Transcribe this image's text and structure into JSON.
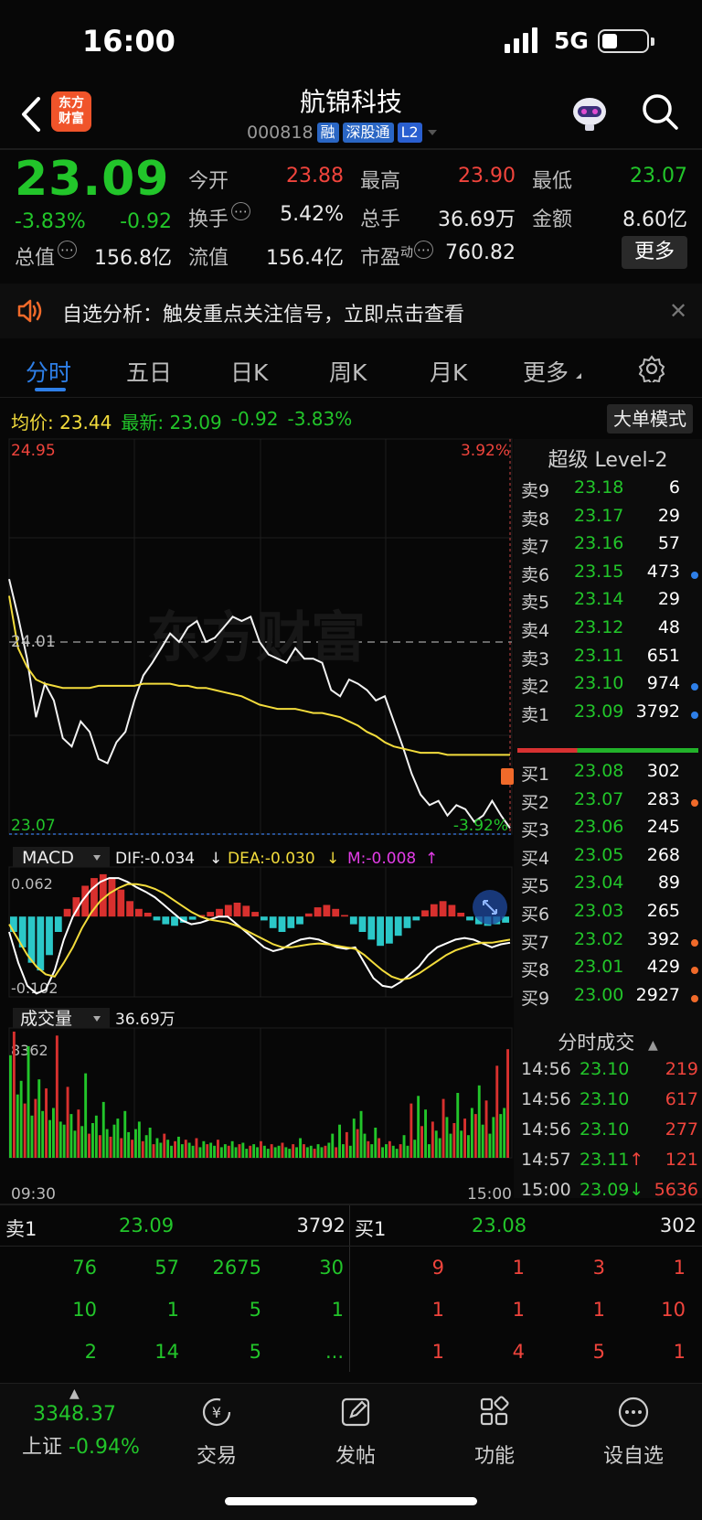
{
  "status": {
    "time": "16:00",
    "network": "5G"
  },
  "header": {
    "logo_text": "东方财富",
    "stock_name": "航锦科技",
    "stock_code": "000818",
    "tags": [
      "融",
      "深股通",
      "L2"
    ]
  },
  "quote": {
    "price": "23.09",
    "change_pct": "-3.83%",
    "change": "-0.92",
    "open_label": "今开",
    "open": "23.88",
    "high_label": "最高",
    "high": "23.90",
    "low_label": "最低",
    "low": "23.07",
    "turnover_label": "换手",
    "turnover": "5.42%",
    "volume_label": "总手",
    "volume": "36.69万",
    "amount_label": "金额",
    "amount": "8.60亿",
    "mktcap_label": "总值",
    "mktcap": "156.8亿",
    "float_label": "流值",
    "float": "156.4亿",
    "pe_label": "市盈",
    "pe_sup": "动",
    "pe": "760.82",
    "more_label": "更多"
  },
  "alert": {
    "text": "自选分析：触发重点关注信号，立即点击查看"
  },
  "tabs": [
    "分时",
    "五日",
    "日K",
    "周K",
    "月K",
    "更多"
  ],
  "info_line": {
    "avg_label": "均价:",
    "avg": "23.44",
    "latest_label": "最新:",
    "latest": "23.09",
    "change": "-0.92",
    "change_pct": "-3.83%"
  },
  "big_order_btn": "大单模式",
  "chart_data": [
    {
      "type": "line",
      "name": "分时",
      "ylim": [
        23.07,
        24.95
      ],
      "y_top_label": "24.95",
      "y_top_pct": "3.92%",
      "y_mid_label": "24.01",
      "y_bottom_label": "23.07",
      "y_bottom_pct": "-3.92%",
      "watermark": "东方财富",
      "x_labels": [
        "09:30",
        "15:00"
      ],
      "price": [
        24.28,
        24.1,
        23.9,
        23.62,
        23.78,
        23.7,
        23.52,
        23.48,
        23.6,
        23.55,
        23.42,
        23.4,
        23.5,
        23.55,
        23.7,
        23.82,
        23.88,
        23.95,
        24.02,
        23.98,
        24.05,
        24.08,
        23.98,
        24.0,
        24.05,
        24.1,
        24.08,
        24.1,
        23.98,
        23.92,
        23.9,
        23.88,
        23.95,
        23.9,
        23.9,
        23.88,
        23.75,
        23.72,
        23.8,
        23.78,
        23.75,
        23.7,
        23.72,
        23.6,
        23.48,
        23.35,
        23.25,
        23.2,
        23.22,
        23.15,
        23.2,
        23.18,
        23.12,
        23.15,
        23.22,
        23.15,
        23.09
      ],
      "avg": [
        24.2,
        23.95,
        23.86,
        23.8,
        23.78,
        23.77,
        23.76,
        23.76,
        23.76,
        23.76,
        23.77,
        23.77,
        23.77,
        23.77,
        23.77,
        23.78,
        23.78,
        23.78,
        23.78,
        23.77,
        23.77,
        23.76,
        23.76,
        23.75,
        23.74,
        23.73,
        23.72,
        23.7,
        23.68,
        23.67,
        23.66,
        23.66,
        23.66,
        23.65,
        23.64,
        23.64,
        23.63,
        23.62,
        23.6,
        23.58,
        23.55,
        23.53,
        23.5,
        23.48,
        23.47,
        23.46,
        23.45,
        23.45,
        23.45,
        23.44,
        23.44,
        23.44,
        23.44,
        23.44,
        23.44,
        23.44,
        23.44
      ]
    },
    {
      "type": "bar",
      "name": "MACD",
      "selector": "MACD",
      "dif_label": "DIF:-0.034",
      "dea_label": "DEA:-0.030",
      "m_label": "M:-0.008",
      "ylim": [
        -0.102,
        0.062
      ],
      "y_top_label": "0.062",
      "y_bottom_label": "-0.102",
      "hist": [
        -0.02,
        -0.04,
        -0.06,
        -0.07,
        -0.05,
        -0.02,
        0.01,
        0.025,
        0.04,
        0.05,
        0.055,
        0.05,
        0.035,
        0.02,
        0.01,
        0.005,
        -0.005,
        -0.01,
        -0.012,
        -0.008,
        -0.004,
        0.002,
        0.006,
        0.01,
        0.015,
        0.018,
        0.014,
        0.006,
        -0.005,
        -0.015,
        -0.02,
        -0.015,
        -0.01,
        0.004,
        0.012,
        0.015,
        0.01,
        0.002,
        -0.01,
        -0.02,
        -0.03,
        -0.038,
        -0.035,
        -0.025,
        -0.015,
        -0.005,
        0.008,
        0.016,
        0.02,
        0.015,
        0.005,
        -0.005,
        -0.01,
        -0.012,
        -0.01,
        -0.008
      ],
      "dif": [
        -0.02,
        -0.06,
        -0.09,
        -0.1,
        -0.095,
        -0.07,
        -0.03,
        0.0,
        0.02,
        0.035,
        0.045,
        0.05,
        0.05,
        0.045,
        0.038,
        0.032,
        0.025,
        0.015,
        0.005,
        -0.005,
        -0.01,
        -0.008,
        -0.004,
        0.0,
        0.0,
        -0.01,
        -0.02,
        -0.03,
        -0.04,
        -0.045,
        -0.042,
        -0.035,
        -0.03,
        -0.028,
        -0.03,
        -0.035,
        -0.04,
        -0.042,
        -0.04,
        -0.06,
        -0.08,
        -0.09,
        -0.092,
        -0.085,
        -0.075,
        -0.065,
        -0.05,
        -0.04,
        -0.035,
        -0.03,
        -0.028,
        -0.03,
        -0.035,
        -0.04,
        -0.036,
        -0.034
      ],
      "dea": [
        -0.01,
        -0.03,
        -0.05,
        -0.065,
        -0.075,
        -0.078,
        -0.06,
        -0.04,
        -0.015,
        0.005,
        0.02,
        0.03,
        0.037,
        0.042,
        0.042,
        0.04,
        0.036,
        0.03,
        0.022,
        0.014,
        0.006,
        0.0,
        -0.004,
        -0.006,
        -0.008,
        -0.012,
        -0.018,
        -0.024,
        -0.03,
        -0.036,
        -0.04,
        -0.04,
        -0.038,
        -0.036,
        -0.035,
        -0.036,
        -0.038,
        -0.04,
        -0.042,
        -0.05,
        -0.06,
        -0.07,
        -0.078,
        -0.082,
        -0.08,
        -0.074,
        -0.066,
        -0.058,
        -0.05,
        -0.044,
        -0.04,
        -0.036,
        -0.034,
        -0.034,
        -0.032,
        -0.03
      ]
    },
    {
      "type": "bar",
      "name": "成交量",
      "selector": "成交量",
      "total_label": "36.69万",
      "y_top_label": "8362",
      "x_labels": [
        "09:30",
        "15:00"
      ],
      "values": [
        6800,
        8362,
        4200,
        5100,
        3600,
        7400,
        2800,
        3900,
        5200,
        3100,
        4600,
        2500,
        3300,
        8100,
        2400,
        2200,
        4700,
        2900,
        1800,
        3200,
        2100,
        5600,
        1600,
        2300,
        2800,
        1500,
        3700,
        1900,
        1400,
        2200,
        2600,
        1300,
        3100,
        1700,
        1200,
        1900,
        2400,
        1100,
        1500,
        2000,
        900,
        1300,
        1000,
        1600,
        1200,
        800,
        1100,
        1400,
        900,
        1200,
        1000,
        800,
        1300,
        700,
        1100,
        900,
        1000,
        800,
        1200,
        700,
        900,
        800,
        1100,
        700,
        900,
        1000,
        600,
        800,
        900,
        700,
        1100,
        800,
        600,
        900,
        700,
        800,
        1000,
        700,
        600,
        900,
        700,
        1300,
        900,
        700,
        800,
        600,
        900,
        700,
        800,
        1000,
        1600,
        700,
        2200,
        900,
        1700,
        800,
        2600,
        1900,
        3100,
        1600,
        1100,
        900,
        2000,
        1300,
        700,
        900,
        1100,
        800,
        600,
        900,
        1500,
        800,
        3600,
        1200,
        4100,
        2100,
        3200,
        900,
        2400,
        1800,
        1300,
        3900,
        2700,
        1600,
        2300,
        4300,
        1800,
        2600,
        1500,
        3300,
        2900,
        4800,
        2200,
        3800,
        1600,
        2700,
        6100,
        2900,
        3300,
        7200
      ],
      "colors": "alternate"
    }
  ],
  "orderbook": {
    "title": "超级 Level-2",
    "sells": [
      {
        "label": "卖9",
        "price": "23.18",
        "vol": "6",
        "dot": ""
      },
      {
        "label": "卖8",
        "price": "23.17",
        "vol": "29",
        "dot": ""
      },
      {
        "label": "卖7",
        "price": "23.16",
        "vol": "57",
        "dot": ""
      },
      {
        "label": "卖6",
        "price": "23.15",
        "vol": "473",
        "dot": "#2e7fe8"
      },
      {
        "label": "卖5",
        "price": "23.14",
        "vol": "29",
        "dot": ""
      },
      {
        "label": "卖4",
        "price": "23.12",
        "vol": "48",
        "dot": ""
      },
      {
        "label": "卖3",
        "price": "23.11",
        "vol": "651",
        "dot": ""
      },
      {
        "label": "卖2",
        "price": "23.10",
        "vol": "974",
        "dot": "#2e7fe8"
      },
      {
        "label": "卖1",
        "price": "23.09",
        "vol": "3792",
        "dot": "#2e7fe8"
      }
    ],
    "buys": [
      {
        "label": "买1",
        "price": "23.08",
        "vol": "302",
        "dot": ""
      },
      {
        "label": "买2",
        "price": "23.07",
        "vol": "283",
        "dot": "#f06a2a"
      },
      {
        "label": "买3",
        "price": "23.06",
        "vol": "245",
        "dot": ""
      },
      {
        "label": "买4",
        "price": "23.05",
        "vol": "268",
        "dot": ""
      },
      {
        "label": "买5",
        "price": "23.04",
        "vol": "89",
        "dot": ""
      },
      {
        "label": "买6",
        "price": "23.03",
        "vol": "265",
        "dot": ""
      },
      {
        "label": "买7",
        "price": "23.02",
        "vol": "392",
        "dot": "#f06a2a"
      },
      {
        "label": "买8",
        "price": "23.01",
        "vol": "429",
        "dot": "#f06a2a"
      },
      {
        "label": "买9",
        "price": "23.00",
        "vol": "2927",
        "dot": "#f06a2a"
      }
    ],
    "trades_title": "分时成交",
    "trades": [
      {
        "time": "14:56",
        "price": "23.10",
        "arrow": "",
        "vol": "219"
      },
      {
        "time": "14:56",
        "price": "23.10",
        "arrow": "",
        "vol": "617"
      },
      {
        "time": "14:56",
        "price": "23.10",
        "arrow": "",
        "vol": "277"
      },
      {
        "time": "14:57",
        "price": "23.11",
        "arrow": "↑",
        "vol": "121"
      },
      {
        "time": "15:00",
        "price": "23.09",
        "arrow": "↓",
        "vol": "5636"
      }
    ]
  },
  "depth": {
    "sell_label": "卖1",
    "sell_price": "23.09",
    "sell_vol": "3792",
    "buy_label": "买1",
    "buy_price": "23.08",
    "buy_vol": "302",
    "sell_rows": [
      [
        "76",
        "57",
        "2675",
        "30"
      ],
      [
        "10",
        "1",
        "5",
        "1"
      ],
      [
        "2",
        "14",
        "5",
        "..."
      ]
    ],
    "buy_rows": [
      [
        "9",
        "1",
        "3",
        "1"
      ],
      [
        "1",
        "1",
        "1",
        "10"
      ],
      [
        "1",
        "4",
        "5",
        "1"
      ]
    ]
  },
  "bottom_nav": {
    "index_value": "3348.37",
    "index_name": "上证",
    "index_change": "-0.94%",
    "items": [
      "交易",
      "发帖",
      "功能",
      "设自选"
    ]
  },
  "colors": {
    "up": "#f0443c",
    "down": "#22c52a",
    "accent": "#2e7fe8",
    "avg_line": "#f3dc3c"
  }
}
